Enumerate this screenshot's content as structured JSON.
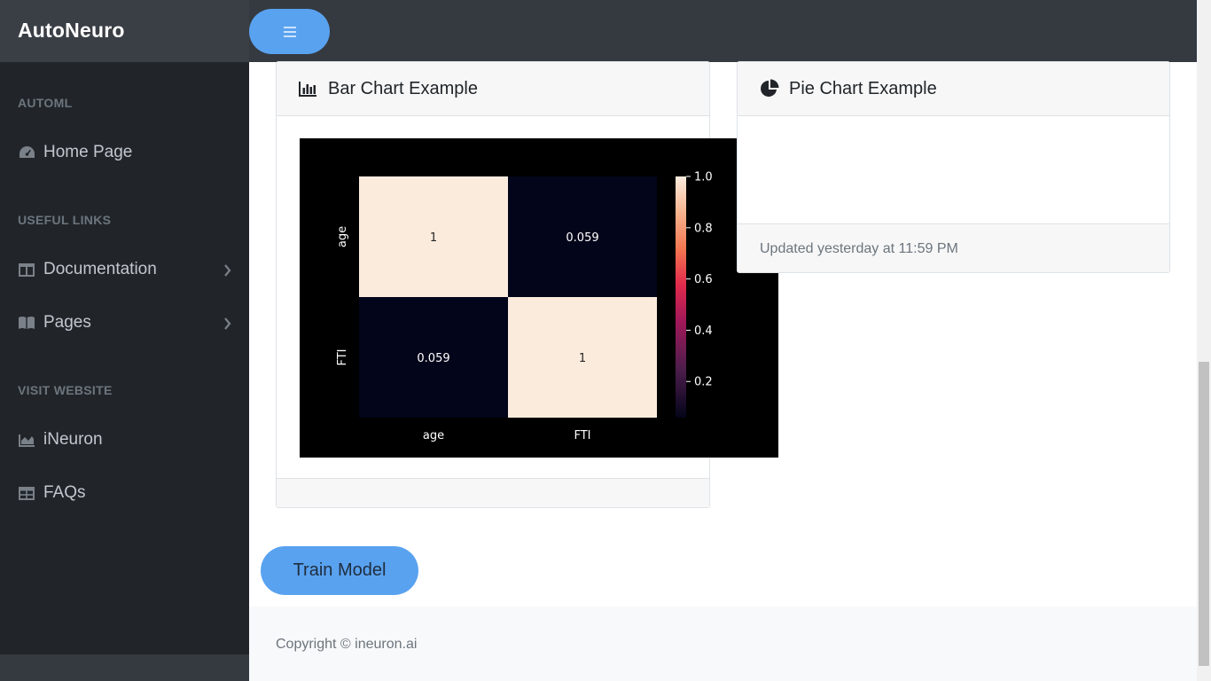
{
  "brand": "AutoNeuro",
  "sidebar": {
    "sections": [
      {
        "heading": "AUTOML",
        "items": [
          {
            "label": "Home Page",
            "icon": "dashboard-icon"
          }
        ]
      },
      {
        "heading": "USEFUL LINKS",
        "items": [
          {
            "label": "Documentation",
            "icon": "columns-icon",
            "has_submenu": true
          },
          {
            "label": "Pages",
            "icon": "book-icon",
            "has_submenu": true
          }
        ]
      },
      {
        "heading": "VISIT WEBSITE",
        "items": [
          {
            "label": "iNeuron",
            "icon": "area-chart-icon"
          },
          {
            "label": "FAQs",
            "icon": "table-icon"
          }
        ]
      }
    ]
  },
  "cards": {
    "bar": {
      "title": "Bar Chart Example",
      "icon": "bar-chart-icon"
    },
    "pie": {
      "title": "Pie Chart Example",
      "icon": "pie-chart-icon",
      "footer": "Updated yesterday at 11:59 PM"
    }
  },
  "train_button": "Train Model",
  "footer": "Copyright © ineuron.ai",
  "colors": {
    "accent": "#59a2f0",
    "sidebar": "#212529",
    "navbar": "#343a40"
  },
  "chart_data": {
    "type": "heatmap",
    "x_labels": [
      "age",
      "FTI"
    ],
    "y_labels": [
      "age",
      "FTI"
    ],
    "values": [
      [
        1,
        0.059
      ],
      [
        0.059,
        1
      ]
    ],
    "annotations": [
      [
        "1",
        "0.059"
      ],
      [
        "0.059",
        "1"
      ]
    ],
    "colorbar": {
      "ticks": [
        "1.0",
        "0.8",
        "0.6",
        "0.4",
        "0.2"
      ],
      "range": [
        0.059,
        1.0
      ]
    },
    "background": "#000000"
  }
}
